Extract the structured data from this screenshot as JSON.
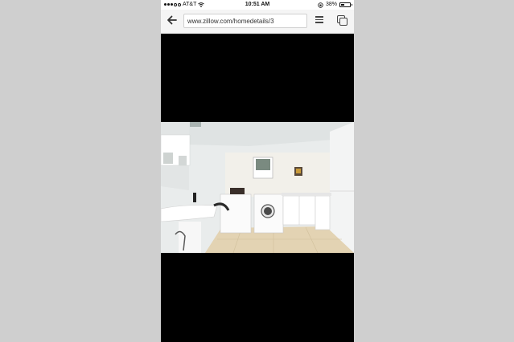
{
  "status_bar": {
    "carrier": "AT&T",
    "time": "10:51 AM",
    "battery": "38%",
    "battery_level": 0.38
  },
  "browser": {
    "url": "www.zillow.com/homedetails/3",
    "back_icon": "arrow-left-icon",
    "menu_icon": "hamburger-menu-icon",
    "tabs_icon": "tabs-icon"
  },
  "photo": {
    "subject": "laundry-room-photo"
  }
}
